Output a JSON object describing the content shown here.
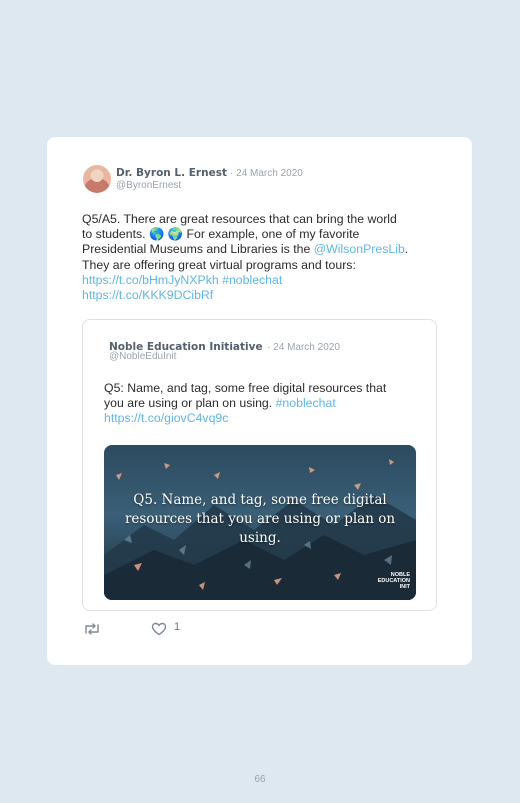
{
  "tweet": {
    "author_name": "Dr. Byron L. Ernest",
    "date": "· 24 March 2020",
    "handle": "@ByronErnest",
    "text_line1": "Q5/A5. There are great resources that can bring the world",
    "text_line2_a": "to students. ",
    "emoji1": "🌎",
    "emoji2": "🌍",
    "text_line2_b": " For example, one of my favorite",
    "text_line3_a": "Presidential Museums and Libraries is the ",
    "mention": "@WilsonPresLib",
    "text_line3_b": ".",
    "text_line4": "They are offering great virtual programs and tours:",
    "link1": "https://t.co/bHmJyNXPkh",
    "hashtag": "#noblechat",
    "link2": "https://t.co/KKK9DCibRf",
    "like_count": "1"
  },
  "quoted": {
    "author_name": "Noble Education Initiative",
    "date": "· 24 March 2020",
    "handle": "@NobleEduInit",
    "text_line1": "Q5: Name, and tag, some free digital resources that",
    "text_line2": "you are using or plan on using. ",
    "hashtag": "#noblechat",
    "link": "https://t.co/giovC4vq9c",
    "media_caption": "Q5. Name, and tag, some free digital resources that you are using or plan on using.",
    "media_logo_line1": "NOBLE",
    "media_logo_line2": "EDUCATION",
    "media_logo_line3": "INIT"
  },
  "page": {
    "number": "66"
  },
  "colors": {
    "background": "#dde8f0",
    "link": "#5fb6e7",
    "card": "#ffffff"
  },
  "icons": [
    "retweet-icon",
    "heart-icon"
  ]
}
